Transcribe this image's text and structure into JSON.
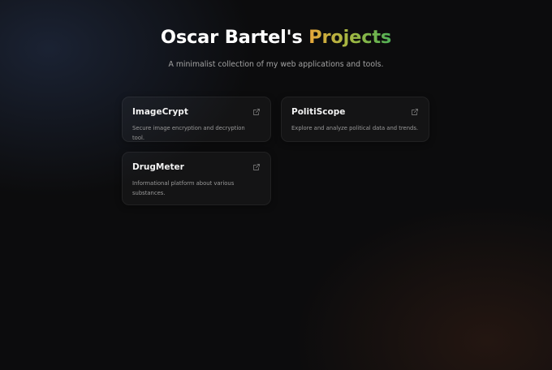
{
  "header": {
    "title_main": "Oscar Bartel's ",
    "title_accent": "Projects",
    "subtitle": "A minimalist collection of my web applications and tools."
  },
  "projects": [
    {
      "name": "ImageCrypt",
      "description": "Secure image encryption and decryption tool.",
      "icon": "external-link-icon"
    },
    {
      "name": "PolitiScope",
      "description": "Explore and analyze political data and trends.",
      "icon": "external-link-icon"
    },
    {
      "name": "DrugMeter",
      "description": "Informational platform about various substances.",
      "icon": "external-link-icon"
    }
  ],
  "colors": {
    "background": "#0c0c0d",
    "accent_start": "#e8a73a",
    "accent_end": "#4fb056"
  }
}
